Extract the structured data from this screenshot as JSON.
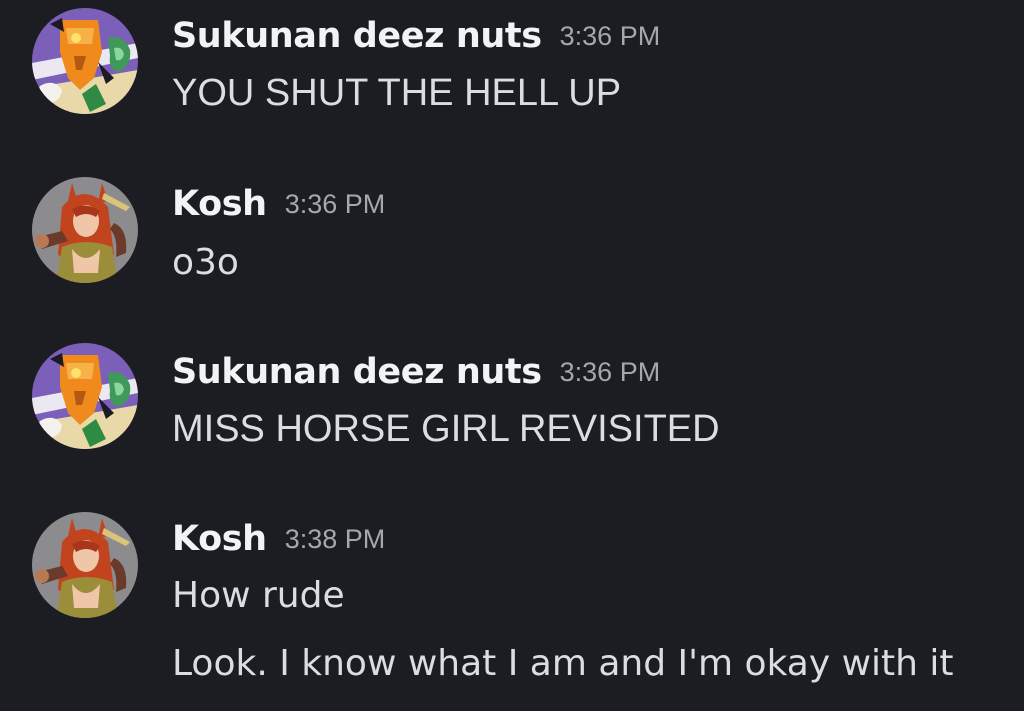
{
  "messages": [
    {
      "username": "Sukunan deez nuts",
      "timestamp": "3:36 PM",
      "lines": [
        "YOU SHUT THE HELL UP"
      ],
      "avatar": "sukunan-avatar"
    },
    {
      "username": "Kosh",
      "timestamp": "3:36 PM",
      "lines": [
        "o3o"
      ],
      "avatar": "kosh-avatar"
    },
    {
      "username": "Sukunan deez nuts",
      "timestamp": "3:36 PM",
      "lines": [
        "MISS HORSE GIRL REVISITED"
      ],
      "avatar": "sukunan-avatar"
    },
    {
      "username": "Kosh",
      "timestamp": "3:38 PM",
      "lines": [
        "How rude",
        "Look. I know what I am and I'm okay with it"
      ],
      "avatar": "kosh-avatar"
    }
  ],
  "colors": {
    "background": "#1c1d22",
    "username": "#f2f3f5",
    "timestamp": "#a4a7ae",
    "message_text": "#dbdee1"
  }
}
